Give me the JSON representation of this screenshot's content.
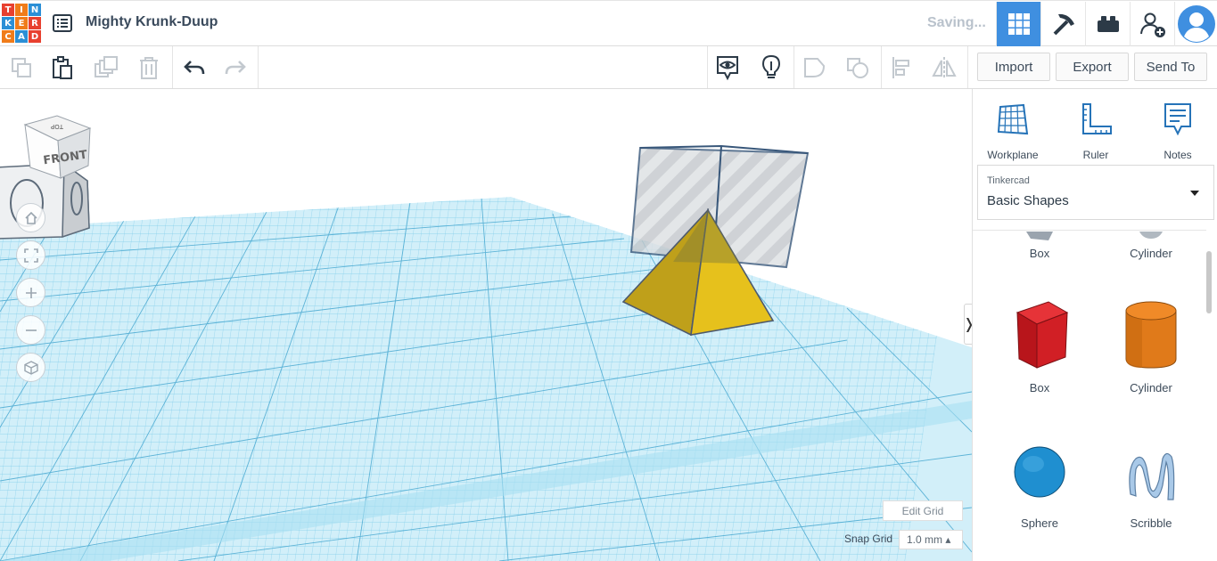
{
  "logo": {
    "letters": [
      "T",
      "I",
      "N",
      "K",
      "E",
      "R",
      "C",
      "A",
      "D"
    ],
    "colors": [
      "#e8402f",
      "#f07c1a",
      "#2b8fd6",
      "#2b8fd6",
      "#f07c1a",
      "#e8402f",
      "#f07c1a",
      "#2b8fd6",
      "#e8402f"
    ]
  },
  "header": {
    "title": "Mighty Krunk-Duup",
    "status": "Saving..."
  },
  "toolbar": {
    "import_label": "Import",
    "export_label": "Export",
    "send_to_label": "Send To"
  },
  "viewcube": {
    "face_label": "FRONT",
    "top_label": "TOP"
  },
  "grid": {
    "edit_label": "Edit Grid",
    "snap_label": "Snap Grid",
    "snap_value": "1.0 mm ▴"
  },
  "panel": {
    "tools": [
      {
        "label": "Workplane"
      },
      {
        "label": "Ruler"
      },
      {
        "label": "Notes"
      }
    ],
    "library": {
      "category": "Tinkercad",
      "value": "Basic Shapes"
    },
    "shapes_partial": [
      "Box",
      "Cylinder"
    ],
    "shapes": [
      {
        "label": "Box"
      },
      {
        "label": "Cylinder"
      },
      {
        "label": "Sphere"
      },
      {
        "label": "Scribble"
      }
    ]
  },
  "colors": {
    "accent": "#3f8fe0",
    "grid": "#8fd3ee",
    "pyramid": "#e6c11c",
    "box_shape": "#d11f25",
    "cylinder_shape": "#e07a1a",
    "sphere_shape": "#1f8fd0"
  }
}
